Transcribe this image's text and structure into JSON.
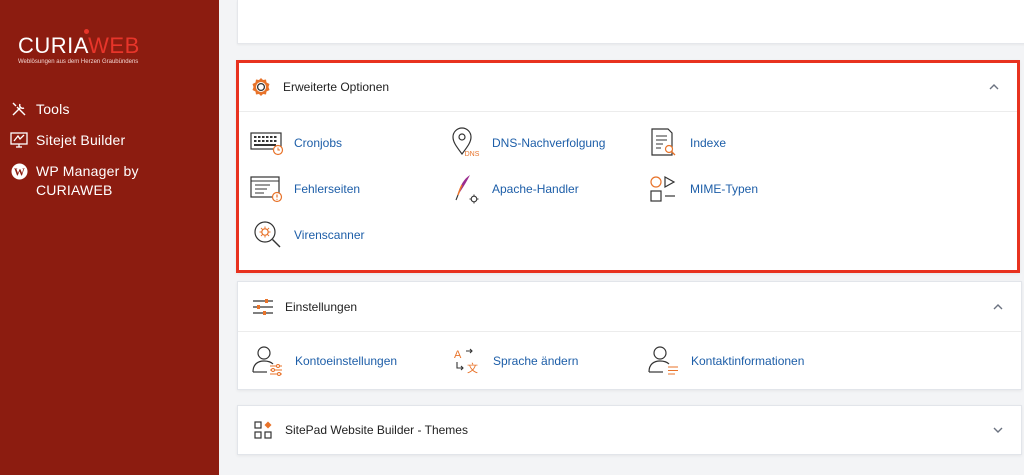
{
  "brand": {
    "name_part1": "CURIA",
    "name_part2": "WEB",
    "tagline": "Weblösungen aus dem Herzen Graubündens"
  },
  "sidebar": {
    "items": [
      {
        "label": "Tools",
        "icon": "tools-icon"
      },
      {
        "label": "Sitejet Builder",
        "icon": "sitejet-icon"
      },
      {
        "label_line1": "WP Manager by",
        "label_line2": "CURIAWEB",
        "icon": "wordpress-icon"
      }
    ]
  },
  "sections": {
    "advanced": {
      "title": "Erweiterte Optionen",
      "expanded": true,
      "items": [
        {
          "label": "Cronjobs",
          "icon": "cron-icon"
        },
        {
          "label": "DNS-Nachverfolgung",
          "icon": "dns-icon"
        },
        {
          "label": "Indexe",
          "icon": "index-icon"
        },
        {
          "label": "Fehlerseiten",
          "icon": "error-pages-icon"
        },
        {
          "label": "Apache-Handler",
          "icon": "apache-icon"
        },
        {
          "label": "MIME-Typen",
          "icon": "mime-icon"
        },
        {
          "label": "Virenscanner",
          "icon": "virus-scanner-icon"
        }
      ]
    },
    "settings": {
      "title": "Einstellungen",
      "expanded": true,
      "items": [
        {
          "label": "Kontoeinstellungen",
          "icon": "account-settings-icon"
        },
        {
          "label": "Sprache ändern",
          "icon": "language-icon"
        },
        {
          "label": "Kontaktinformationen",
          "icon": "contact-icon"
        }
      ]
    },
    "sitepad": {
      "title": "SitePad Website Builder - Themes",
      "expanded": false
    }
  },
  "colors": {
    "sidebar": "#8c1c10",
    "accent": "#e8352a",
    "highlight_border": "#e8321f",
    "link": "#1d5ea8",
    "icon_orange": "#e8732a"
  }
}
